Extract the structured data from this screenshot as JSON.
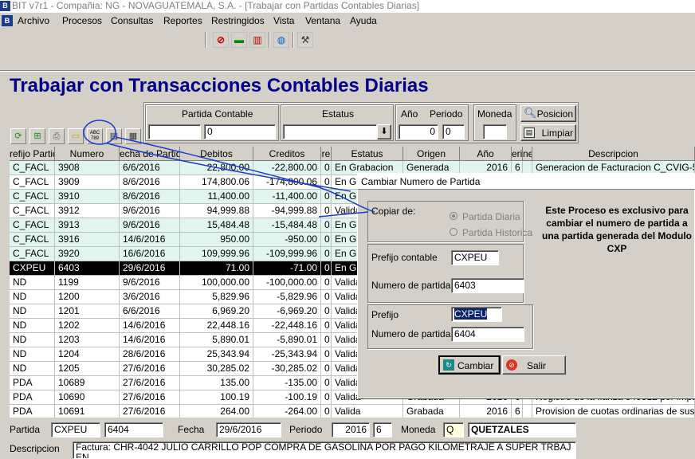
{
  "window_title": "BIT v7r1 - Compañia: NG - NOVAGUATEMALA, S.A. - [Trabajar con Partidas Contables Diarias]",
  "app_logo": "B",
  "menu": [
    "Archivo",
    "Procesos",
    "Consultas",
    "Reportes",
    "Restringidos",
    "Vista",
    "Ventana",
    "Ayuda"
  ],
  "toolbar_icons": [
    "stop-icon",
    "train-icon",
    "book-icon",
    "globe-icon",
    "tools-icon"
  ],
  "page_title": "Trabajar con Transacciones Contables Diarias",
  "filters": {
    "partida_label": "Partida Contable",
    "partida_prefix": "",
    "partida_number": "0",
    "estatus_label": "Estatus",
    "estatus_value": "",
    "anio_label": "Año",
    "anio_value": "0",
    "periodo_label": "Periodo",
    "periodo_value": "0",
    "moneda_label": "Moneda",
    "moneda_value": "",
    "posicion_label": "Posicion",
    "limpiar_label": "Limpiar"
  },
  "side_icons": [
    "refresh-icon",
    "add-icon",
    "print-icon",
    "folder-icon",
    "abc-icon",
    "printer-icon",
    "calculator-icon"
  ],
  "abc_icon_text": "ABC\n789",
  "grid": {
    "headers": [
      "refijo Partid",
      "Numero",
      "echa de Partida",
      "Debitos",
      "Creditos",
      "re",
      "Estatus",
      "Origen",
      "Año",
      "erio",
      "ne",
      "Descripcion"
    ],
    "rows": [
      {
        "style": "teal",
        "cells": [
          "C_FACL",
          "3908",
          "6/6/2016",
          "22,800.00",
          "-22,800.00",
          "0",
          "En Grabacion",
          "Generada",
          "2016",
          "6",
          "",
          "Generacion de Facturacion  C_CVIG-5500"
        ]
      },
      {
        "style": "white",
        "cells": [
          "C_FACL",
          "3909",
          "8/6/2016",
          "174,800.06",
          "-174,800.06",
          "0",
          "En Gr",
          "",
          "",
          "",
          "",
          ""
        ]
      },
      {
        "style": "teal",
        "cells": [
          "C_FACL",
          "3910",
          "8/6/2016",
          "11,400.00",
          "-11,400.00",
          "0",
          "En Gr",
          "",
          "",
          "",
          "",
          ""
        ]
      },
      {
        "style": "white",
        "cells": [
          "C_FACL",
          "3912",
          "9/6/2016",
          "94,999.88",
          "-94,999.88",
          "0",
          "Valida",
          "",
          "",
          "",
          "",
          ""
        ]
      },
      {
        "style": "teal",
        "cells": [
          "C_FACL",
          "3913",
          "9/6/2016",
          "15,484.48",
          "-15,484.48",
          "0",
          "En Gr",
          "",
          "",
          "",
          "",
          ""
        ]
      },
      {
        "style": "teal",
        "cells": [
          "C_FACL",
          "3916",
          "14/6/2016",
          "950.00",
          "-950.00",
          "0",
          "En Gr",
          "",
          "",
          "",
          "",
          ""
        ]
      },
      {
        "style": "teal",
        "cells": [
          "C_FACL",
          "3920",
          "16/6/2016",
          "109,999.96",
          "-109,999.96",
          "0",
          "En Gr",
          "",
          "",
          "",
          "",
          ""
        ]
      },
      {
        "style": "sel",
        "cells": [
          "CXPEU",
          "6403",
          "29/6/2016",
          "71.00",
          "-71.00",
          "0",
          "En Gr",
          "",
          "",
          "",
          "",
          ""
        ]
      },
      {
        "style": "white",
        "cells": [
          "ND",
          "1199",
          "9/6/2016",
          "100,000.00",
          "-100,000.00",
          "0",
          "Valida",
          "",
          "",
          "",
          "",
          ""
        ]
      },
      {
        "style": "white",
        "cells": [
          "ND",
          "1200",
          "3/6/2016",
          "5,829.96",
          "-5,829.96",
          "0",
          "Valida",
          "",
          "",
          "",
          "",
          ""
        ]
      },
      {
        "style": "white",
        "cells": [
          "ND",
          "1201",
          "6/6/2016",
          "6,969.20",
          "-6,969.20",
          "0",
          "Valida",
          "",
          "",
          "",
          "",
          ""
        ]
      },
      {
        "style": "white",
        "cells": [
          "ND",
          "1202",
          "14/6/2016",
          "22,448.16",
          "-22,448.16",
          "0",
          "Valida",
          "",
          "",
          "",
          "",
          ""
        ]
      },
      {
        "style": "white",
        "cells": [
          "ND",
          "1203",
          "14/6/2016",
          "5,890.01",
          "-5,890.01",
          "0",
          "Valida",
          "",
          "",
          "",
          "",
          ""
        ]
      },
      {
        "style": "white",
        "cells": [
          "ND",
          "1204",
          "28/6/2016",
          "25,343.94",
          "-25,343.94",
          "0",
          "Valida",
          "",
          "",
          "",
          "",
          ""
        ]
      },
      {
        "style": "white",
        "cells": [
          "ND",
          "1205",
          "27/6/2016",
          "30,285.02",
          "-30,285.02",
          "0",
          "Valida",
          "",
          "",
          "",
          "",
          ""
        ]
      },
      {
        "style": "white",
        "cells": [
          "PDA",
          "10689",
          "27/6/2016",
          "135.00",
          "-135.00",
          "0",
          "Valida",
          "",
          "",
          "",
          "",
          ""
        ]
      },
      {
        "style": "white",
        "cells": [
          "PDA",
          "10690",
          "27/6/2016",
          "100.19",
          "-100.19",
          "0",
          "Valida",
          "Grabada",
          "2016",
          "6",
          "",
          "Registro de la fianza 549812 por impacto am"
        ]
      },
      {
        "style": "white",
        "cells": [
          "PDA",
          "10691",
          "27/6/2016",
          "264.00",
          "-264.00",
          "0",
          "Valida",
          "Grabada",
          "2016",
          "6",
          "",
          "Provision de cuotas ordinarias de suscriptor"
        ]
      }
    ]
  },
  "dialog": {
    "title": "Cambiar Numero de Partida",
    "copiar_label": "Copiar de:",
    "radio_diaria": "Partida Diaria",
    "radio_historica": "Partida Historica",
    "info_text": "Este Proceso es exclusivo para cambiar el numero de partida a una partida generada del Modulo CXP",
    "prefijo_contable_label": "Prefijo contable",
    "prefijo_contable_value": "CXPEU",
    "numero_partida_label": "Numero de partida",
    "numero_partida_value": "6403",
    "prefijo_label": "Prefijo",
    "prefijo_value": "CXPEU",
    "numero_nuevo_label": "Numero de partida",
    "numero_nuevo_value": "6404",
    "cambiar_label": "Cambiar",
    "salir_label": "Salir"
  },
  "bottom": {
    "partida_label": "Partida",
    "partida_prefix": "CXPEU",
    "partida_number": "6404",
    "fecha_label": "Fecha",
    "fecha_value": "29/6/2016",
    "periodo_label": "Periodo",
    "anio_value": "2016",
    "periodo_value": "6",
    "moneda_label": "Moneda",
    "moneda_code": "Q",
    "moneda_name": "QUETZALES",
    "descripcion_label": "Descripcion",
    "descripcion_value": "Factura: CHR-4042 JULIO CARRILLO POP COMPRA DE GASOLINA POR PAGO KILOMETRAJE A SUPER TRBAJ EN"
  },
  "colors": {
    "title_blue": "#00008b",
    "selection": "#000000",
    "annotation_blue": "#1a3ccc",
    "row_teal": "#e0f4f0"
  }
}
